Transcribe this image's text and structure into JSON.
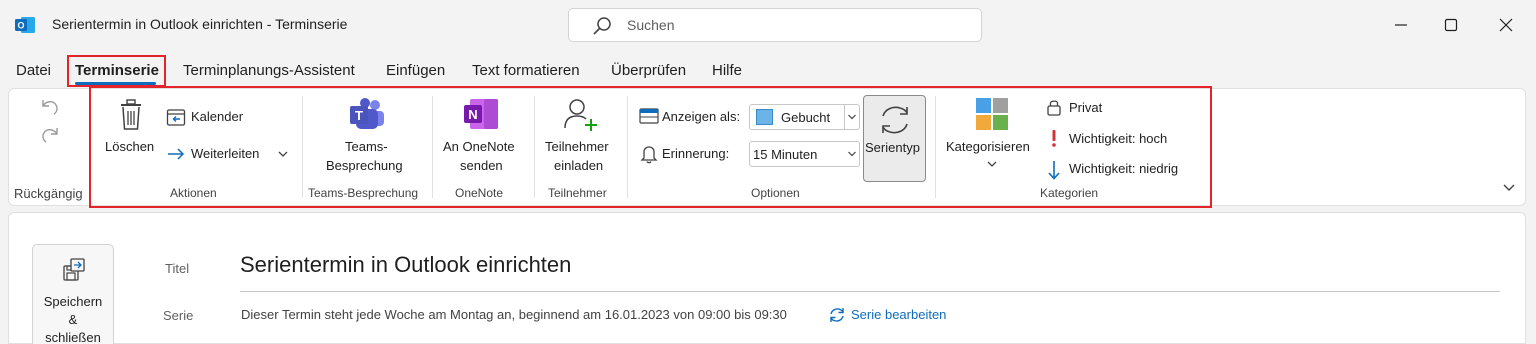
{
  "window": {
    "title": "Serientermin in Outlook einrichten  -  Terminserie",
    "search_placeholder": "Suchen"
  },
  "tabs": [
    "Datei",
    "Terminserie",
    "Terminplanungs-Assistent",
    "Einfügen",
    "Text formatieren",
    "Überprüfen",
    "Hilfe"
  ],
  "ribbon": {
    "undo_group": "Rückgängig",
    "aktionen": {
      "loeschen": "Löschen",
      "kalender": "Kalender",
      "weiterleiten": "Weiterleiten",
      "group": "Aktionen"
    },
    "teams": {
      "line1": "Teams-",
      "line2": "Besprechung",
      "group": "Teams-Besprechung"
    },
    "onenote": {
      "line1": "An OneNote",
      "line2": "senden",
      "group": "OneNote"
    },
    "teilnehmer": {
      "line1": "Teilnehmer",
      "line2": "einladen",
      "group": "Teilnehmer"
    },
    "optionen": {
      "anzeigen_als": "Anzeigen als:",
      "anzeigen_value": "Gebucht",
      "erinnerung": "Erinnerung:",
      "erinnerung_value": "15 Minuten",
      "serientyp": "Serientyp",
      "group": "Optionen"
    },
    "kategorien": {
      "kategorisieren": "Kategorisieren",
      "privat": "Privat",
      "wichtig_hoch": "Wichtigkeit: hoch",
      "wichtig_niedrig": "Wichtigkeit: niedrig",
      "group": "Kategorien"
    }
  },
  "form": {
    "save_line1": "Speichern",
    "save_line2": "&",
    "save_line3": "schließen",
    "titel_label": "Titel",
    "titel_value": "Serientermin in Outlook einrichten",
    "serie_label": "Serie",
    "serie_text": "Dieser Termin steht jede Woche am Montag an, beginnend am 16.01.2023 von 09:00 bis 09:30",
    "serie_link": "Serie bearbeiten"
  },
  "colors": {
    "accent": "#0f6cbd",
    "highlight_red": "#e3242b",
    "gebucht_swatch": "#6cb4e8"
  }
}
